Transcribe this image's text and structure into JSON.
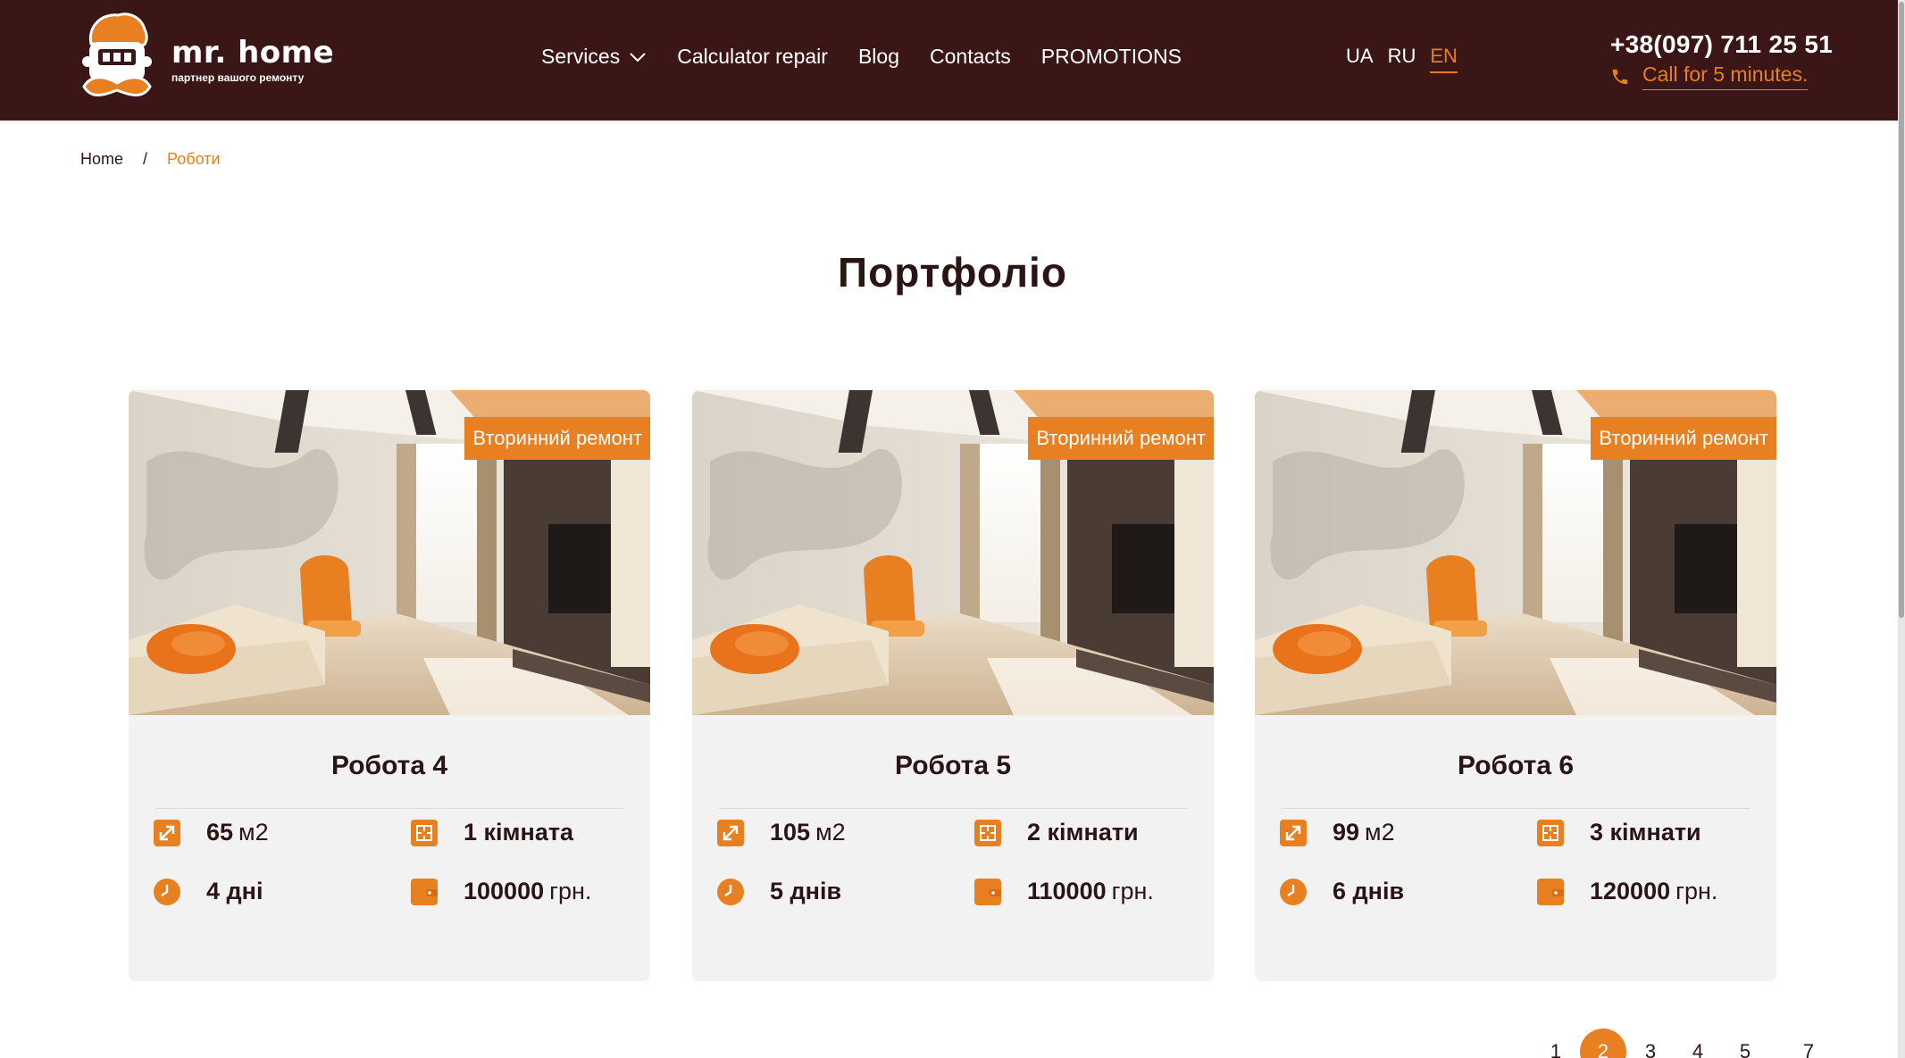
{
  "header": {
    "logo_title": "mr. home",
    "logo_subtitle": "партнер вашого ремонту",
    "nav": [
      {
        "label": "Services",
        "has_dropdown": true
      },
      {
        "label": "Calculator repair"
      },
      {
        "label": "Blog"
      },
      {
        "label": "Contacts"
      },
      {
        "label": "PROMOTIONS"
      }
    ],
    "languages": [
      {
        "label": "UA",
        "active": false
      },
      {
        "label": "RU",
        "active": false
      },
      {
        "label": "EN",
        "active": true
      }
    ],
    "phone": "+38(097) 711 25 51",
    "callback_label": "Call for 5 minutes."
  },
  "breadcrumb": {
    "home": "Home",
    "separator": "/",
    "current": "Роботи"
  },
  "page_title": "Портфоліо",
  "cards": [
    {
      "badge": "Вторинний ремонт",
      "title": "Робота 4",
      "area_value": "65",
      "area_unit": "м2",
      "rooms": "1 кімната",
      "days": "4 дні",
      "price_value": "100000",
      "price_unit": "грн."
    },
    {
      "badge": "Вторинний ремонт",
      "title": "Робота 5",
      "area_value": "105",
      "area_unit": "м2",
      "rooms": "2 кімнати",
      "days": "5 днів",
      "price_value": "110000",
      "price_unit": "грн."
    },
    {
      "badge": "Вторинний ремонт",
      "title": "Робота 6",
      "area_value": "99",
      "area_unit": "м2",
      "rooms": "3 кімнати",
      "days": "6 днів",
      "price_value": "120000",
      "price_unit": "грн."
    }
  ],
  "pagination": {
    "pages": [
      "1",
      "2",
      "3",
      "4",
      "5",
      "7"
    ],
    "active": "2"
  },
  "colors": {
    "header_bg": "#3a1616",
    "accent": "#e87f21",
    "text": "#2b1414",
    "card_bg": "#f2f2f2"
  },
  "icons": {
    "area": "resize-arrows-icon",
    "rooms": "floor-plan-icon",
    "days": "clock-icon",
    "price": "wallet-icon",
    "callback": "phone-icon",
    "dropdown": "chevron-down-icon"
  }
}
